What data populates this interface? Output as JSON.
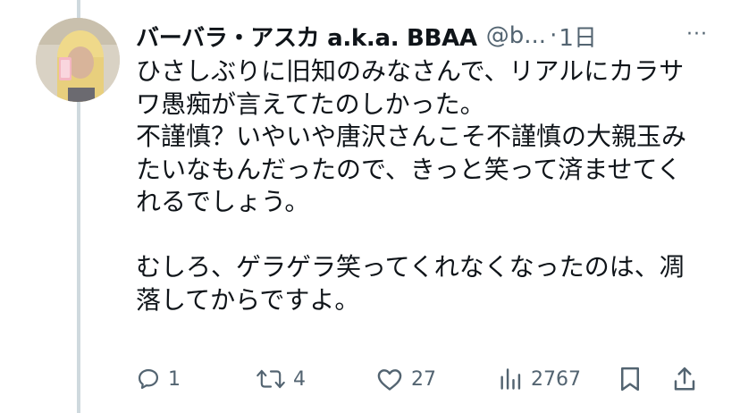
{
  "post": {
    "author_name": "バーバラ・アスカ a.k.a. BBAA",
    "handle": "@b...",
    "separator": "·",
    "time": "1日",
    "more_glyph": "···",
    "text": "ひさしぶりに旧知のみなさんで、リアルにカラサワ愚痴が言えてたのしかった。\n不謹慎？いやいや唐沢さんこそ不謹慎の大親玉みたいなもんだったので、きっと笑って済ませてくれるでしょう。\n\nむしろ、ゲラゲラ笑ってくれなくなったのは、凋落してからですよ。"
  },
  "actions": {
    "reply_count": "1",
    "repost_count": "4",
    "like_count": "27",
    "view_count": "2767"
  },
  "icons": {
    "reply": "reply-icon",
    "repost": "repost-icon",
    "like": "heart-icon",
    "views": "views-icon",
    "bookmark": "bookmark-icon",
    "share": "share-icon"
  },
  "colors": {
    "text": "#0f1419",
    "secondary": "#536471",
    "thread_line": "#cfd9de"
  }
}
